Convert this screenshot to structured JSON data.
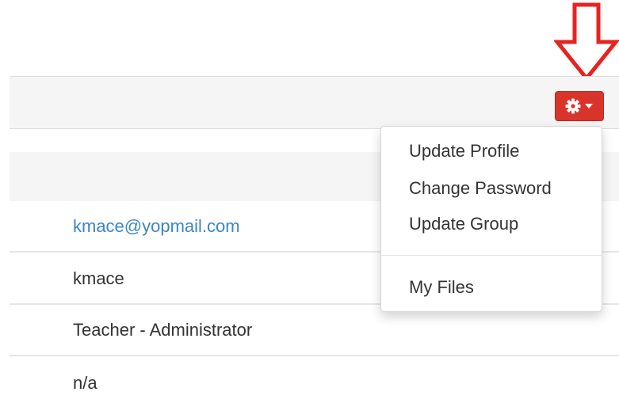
{
  "toolbar": {
    "settings_icon": "gear-icon",
    "caret_icon": "caret-down-icon",
    "button_color": "#d9342b"
  },
  "annotation": {
    "icon": "down-arrow-icon",
    "color": "#e8231f"
  },
  "dropdown": {
    "items": [
      {
        "label": "Update Profile"
      },
      {
        "label": "Change Password"
      },
      {
        "label": "Update Group"
      },
      {
        "label": "My Files"
      }
    ]
  },
  "profile": {
    "rows": [
      {
        "value": "kmace@yopmail.com"
      },
      {
        "value": "kmace"
      },
      {
        "value": "Teacher - Administrator"
      },
      {
        "value": "n/a"
      }
    ]
  },
  "colors": {
    "link": "#3a86c8",
    "header_bg": "#f5f5f5"
  }
}
